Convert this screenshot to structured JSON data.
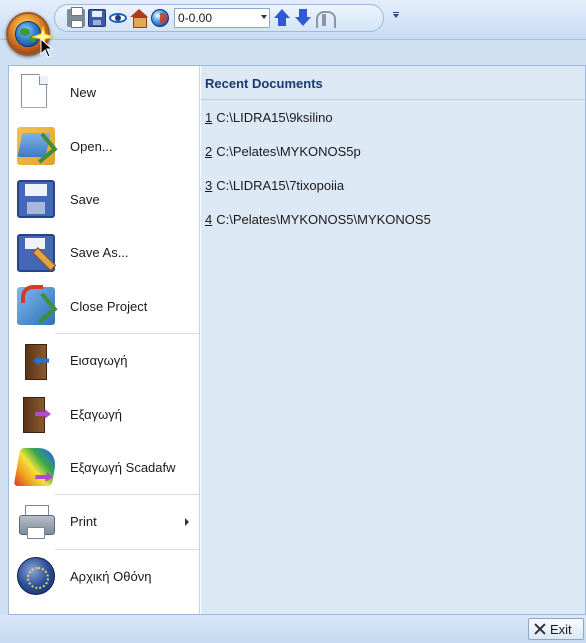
{
  "toolbar": {
    "elevation_value": "0-0.00",
    "icons": [
      "print-icon",
      "save-icon",
      "eye-icon",
      "house-icon",
      "globe-icon",
      "arrow-up-icon",
      "arrow-down-icon",
      "arch-icon"
    ]
  },
  "menu": {
    "items": [
      {
        "label": "New",
        "icon": "new-document-icon"
      },
      {
        "label": "Open...",
        "icon": "open-icon"
      },
      {
        "label": "Save",
        "icon": "save-icon"
      },
      {
        "label": "Save As...",
        "icon": "save-as-icon"
      },
      {
        "label": "Close Project",
        "icon": "close-project-icon"
      },
      {
        "label": "Εισαγωγή",
        "icon": "import-icon"
      },
      {
        "label": "Εξαγωγή",
        "icon": "export-icon"
      },
      {
        "label": "Εξαγωγή Scadafw",
        "icon": "export-scadafw-icon"
      },
      {
        "label": "Print",
        "icon": "print-icon"
      },
      {
        "label": "Αρχική Οθόνη",
        "icon": "home-screen-icon"
      }
    ]
  },
  "recent": {
    "header": "Recent Documents",
    "items": [
      {
        "num": "1",
        "path": "C:\\LIDRA15\\9ksilino"
      },
      {
        "num": "2",
        "path": "C:\\Pelates\\MYKONOS5p"
      },
      {
        "num": "3",
        "path": "C:\\LIDRA15\\7tixopoiia"
      },
      {
        "num": "4",
        "path": "C:\\Pelates\\MYKONOS5\\MYKONOS5"
      }
    ]
  },
  "footer": {
    "exit_label": "Exit"
  },
  "colors": {
    "accent": "#173b6e",
    "panel_bg": "#dde8f5",
    "chrome_bg": "#cfe0f3"
  }
}
